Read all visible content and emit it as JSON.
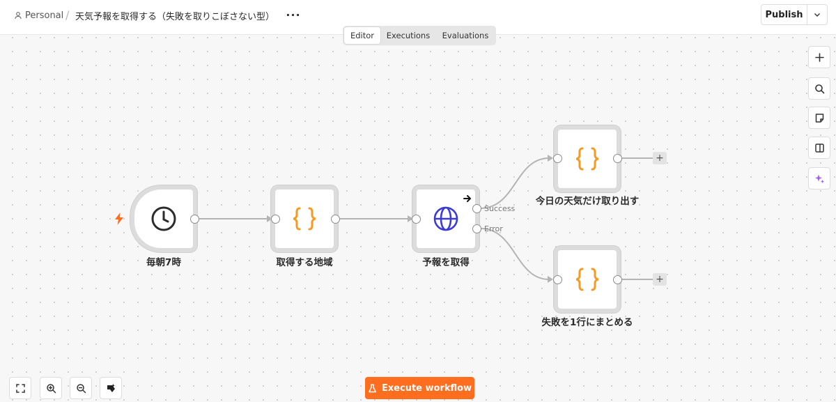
{
  "header": {
    "project": "Personal",
    "separator": "/",
    "workflow_title": "天気予報を取得する（失敗を取りこぼさない型）",
    "more": "···",
    "publish_label": "Publish"
  },
  "tabs": [
    {
      "label": "Editor",
      "active": true
    },
    {
      "label": "Executions",
      "active": false
    },
    {
      "label": "Evaluations",
      "active": false
    }
  ],
  "nodes": {
    "trigger": {
      "label": "毎朝7時",
      "icon": "clock-icon"
    },
    "region": {
      "label": "取得する地域",
      "icon": "code-braces-icon"
    },
    "forecast": {
      "label": "予報を取得",
      "icon": "globe-icon"
    },
    "today": {
      "label": "今日の天気だけ取り出す",
      "icon": "code-braces-icon"
    },
    "failure": {
      "label": "失敗を1行にまとめる",
      "icon": "code-braces-icon"
    }
  },
  "outputs": {
    "success": "Success",
    "error": "Error"
  },
  "add_symbol": "+",
  "right_toolbar": [
    "plus-icon",
    "search-icon",
    "sticky-note-icon",
    "panel-icon",
    "sparkle-icon"
  ],
  "bottom_toolbar": [
    "fit-view-icon",
    "zoom-in-icon",
    "zoom-out-icon",
    "tidy-up-icon"
  ],
  "execute_label": "Execute workflow",
  "colors": {
    "accent": "#ff6d1f",
    "code_icon": "#f59b24",
    "globe_icon": "#3b3bd6",
    "trigger_bolt": "#ff6d1f",
    "sparkle": "#a05cf0"
  }
}
